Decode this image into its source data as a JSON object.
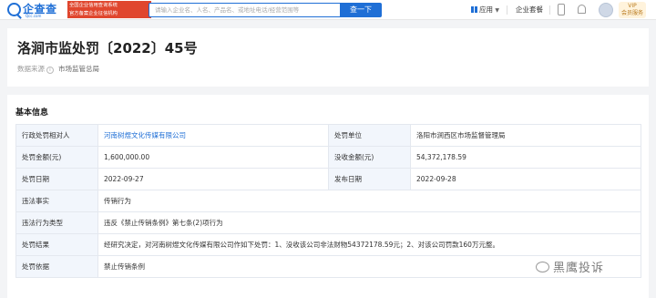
{
  "header": {
    "logo_text": "企查查",
    "logo_sub": "Qcc.com",
    "tagline_1": "全国企业信用查询系统",
    "tagline_2": "官方备案企业征信机构",
    "search_placeholder": "请输入企业名、人名、产品名、或地址电话/经营范围等",
    "search_button": "查一下",
    "nav_app": "应用",
    "nav_package": "企业套餐",
    "vip_label_1": "VIP",
    "vip_label_2": "会员服务"
  },
  "title_card": {
    "title": "洛涧市监处罚〔2022〕45号",
    "source_label": "数据来源",
    "source_value": "市场监管总局"
  },
  "info": {
    "section_title": "基本信息",
    "rows": [
      {
        "l1": "行政处罚相对人",
        "v1": "河南树煜文化传媒有限公司",
        "l2": "处罚单位",
        "v2": "洛阳市涧西区市场监督管理局"
      },
      {
        "l1": "处罚金额(元)",
        "v1": "1,600,000.00",
        "l2": "没收金额(元)",
        "v2": "54,372,178.59"
      },
      {
        "l1": "处罚日期",
        "v1": "2022-09-27",
        "l2": "发布日期",
        "v2": "2022-09-28"
      },
      {
        "l1": "违法事实",
        "v1": "传销行为"
      },
      {
        "l1": "违法行为类型",
        "v1": "违反《禁止传销条例》第七条(2)项行为"
      },
      {
        "l1": "处罚结果",
        "v1": "经研究决定，对河南树煜文化传媒有限公司作如下处罚：1、没收该公司非法财物54372178.59元；2、对该公司罚款160万元整。"
      },
      {
        "l1": "处罚依据",
        "v1": "禁止传销条例"
      }
    ]
  },
  "watermark": "黑鹰投诉"
}
